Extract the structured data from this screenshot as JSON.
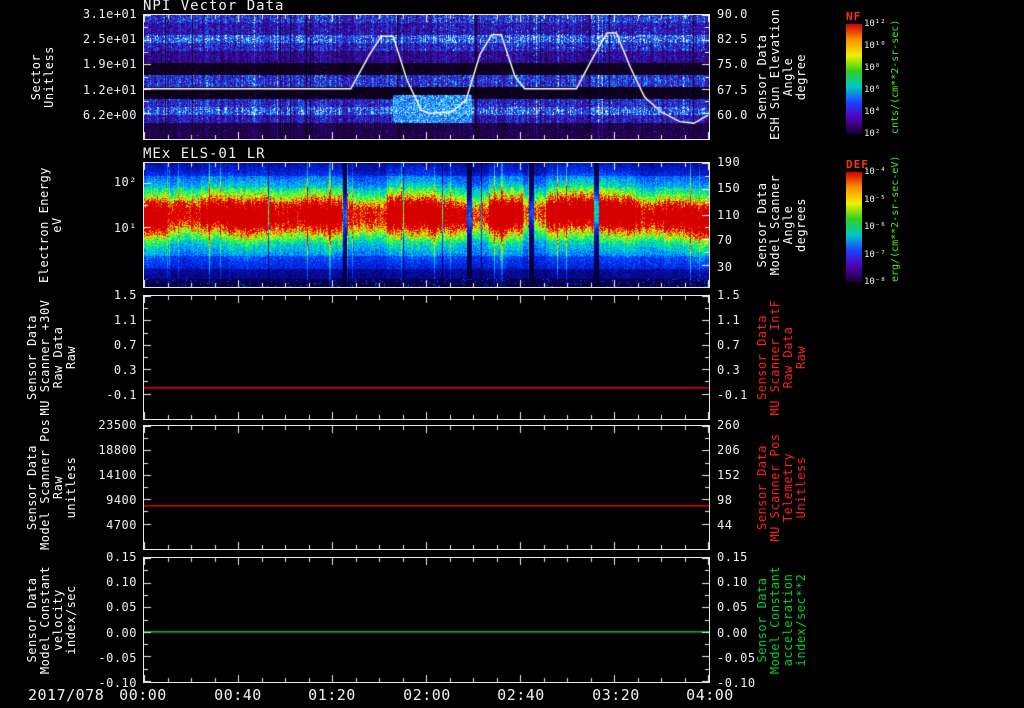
{
  "xaxis": {
    "date_label": "2017/078",
    "tick_labels": [
      "00:00",
      "00:40",
      "01:20",
      "02:00",
      "02:40",
      "03:20",
      "04:00"
    ],
    "t_range_min": [
      0,
      240
    ]
  },
  "chart_data": [
    {
      "type": "spectrogram",
      "title": "NPI Vector Data",
      "ylabel_left_lines": [
        "Sector",
        "Unitless"
      ],
      "yticks_left": [
        {
          "label": "3.1e+01",
          "frac": 0.0
        },
        {
          "label": "2.5e+01",
          "frac": 0.2
        },
        {
          "label": "1.9e+01",
          "frac": 0.4
        },
        {
          "label": "1.2e+01",
          "frac": 0.6
        },
        {
          "label": "6.2e+00",
          "frac": 0.8
        }
      ],
      "ylabel_right_lines": [
        "Sensor Data",
        "ESH Sun Elevation",
        "Angle",
        "degree"
      ],
      "ylabel_right_color": "#ffffff",
      "yticks_right": [
        {
          "label": "90.0",
          "frac": 0.0
        },
        {
          "label": "82.5",
          "frac": 0.2
        },
        {
          "label": "75.0",
          "frac": 0.4
        },
        {
          "label": "67.5",
          "frac": 0.6
        },
        {
          "label": "60.0",
          "frac": 0.8
        }
      ],
      "colorbar": {
        "label": "NF",
        "label_color": "#ff3018",
        "tick_labels": [
          "10¹²",
          "10¹⁰",
          "10⁸",
          "10⁶",
          "10⁴",
          "10²"
        ],
        "units": "cnts/(cm**2-sr-sec)",
        "units_color": "#58e818",
        "gradient": [
          "#d00000",
          "#ff9000",
          "#f0f000",
          "#30d020",
          "#00c8c8",
          "#2040ff",
          "#5000b0",
          "#180030"
        ]
      },
      "overlay_line": {
        "name": "ESH Sun Elevation Angle",
        "color": "#ffffff",
        "units": "degrees",
        "axis": {
          "top_value": 90.0,
          "bottom_value": 52.5
        },
        "points": [
          [
            0,
            67.5
          ],
          [
            88,
            67.5
          ],
          [
            96,
            78
          ],
          [
            101,
            83.5
          ],
          [
            106,
            83.5
          ],
          [
            112,
            70
          ],
          [
            118,
            61
          ],
          [
            122,
            60
          ],
          [
            131,
            60.5
          ],
          [
            137,
            64
          ],
          [
            143,
            78
          ],
          [
            148,
            84
          ],
          [
            152,
            84
          ],
          [
            158,
            71
          ],
          [
            162,
            67.5
          ],
          [
            184,
            67.5
          ],
          [
            191,
            77
          ],
          [
            197,
            84.5
          ],
          [
            201,
            84.5
          ],
          [
            207,
            74
          ],
          [
            213,
            65
          ],
          [
            220,
            60.5
          ],
          [
            228,
            57.5
          ],
          [
            234,
            57
          ],
          [
            240,
            59.5
          ]
        ]
      },
      "texture": {
        "row_profile": [
          {
            "f0": 0.0,
            "f1": 0.08,
            "v": 0.5
          },
          {
            "f0": 0.08,
            "f1": 0.15,
            "v": 0.38
          },
          {
            "f0": 0.15,
            "f1": 0.22,
            "v": 0.62
          },
          {
            "f0": 0.22,
            "f1": 0.3,
            "v": 0.45
          },
          {
            "f0": 0.3,
            "f1": 0.38,
            "v": 0.3
          },
          {
            "f0": 0.38,
            "f1": 0.48,
            "v": 0.07
          },
          {
            "f0": 0.48,
            "f1": 0.58,
            "v": 0.5
          },
          {
            "f0": 0.58,
            "f1": 0.67,
            "v": 0.06
          },
          {
            "f0": 0.67,
            "f1": 0.74,
            "v": 0.45
          },
          {
            "f0": 0.74,
            "f1": 0.8,
            "v": 0.62
          },
          {
            "f0": 0.8,
            "f1": 0.88,
            "v": 0.4
          },
          {
            "f0": 0.88,
            "f1": 1.01,
            "v": 0.16
          }
        ]
      }
    },
    {
      "type": "spectrogram",
      "title": "MEx ELS-01 LR",
      "yscale": "log",
      "ylabel_left_lines": [
        "Electron Energy",
        "eV"
      ],
      "yticks_left": [
        {
          "label": "10²",
          "frac": 0.16
        },
        {
          "label": "10¹",
          "frac": 0.52
        }
      ],
      "ylabel_right_lines": [
        "Sensor Data",
        "Model Scanner",
        "Angle",
        "degrees"
      ],
      "ylabel_right_color": "#ffffff",
      "yticks_right": [
        {
          "label": "190",
          "frac": 0.0
        },
        {
          "label": "150",
          "frac": 0.21
        },
        {
          "label": "110",
          "frac": 0.42
        },
        {
          "label": "70",
          "frac": 0.62
        },
        {
          "label": "30",
          "frac": 0.83
        }
      ],
      "colorbar": {
        "label": "DEF",
        "label_color": "#ff3018",
        "tick_labels": [
          "10⁻⁴",
          "10⁻⁵",
          "10⁻⁶",
          "10⁻⁷",
          "10⁻⁸"
        ],
        "units": "erg/(cm**2-sr-sec-eV)",
        "units_color": "#58e818",
        "gradient": [
          "#d00000",
          "#ff9000",
          "#f0f000",
          "#30d020",
          "#00c8c8",
          "#2040ff",
          "#5000b0",
          "#180030"
        ]
      },
      "texture": {
        "amp_profile": [
          [
            0,
            0.04,
            1.0
          ],
          [
            0.04,
            0.1,
            0.7
          ],
          [
            0.1,
            0.15,
            0.9
          ],
          [
            0.15,
            0.23,
            1.0
          ],
          [
            0.23,
            0.28,
            0.8
          ],
          [
            0.28,
            0.35,
            0.95
          ],
          [
            0.35,
            0.43,
            0.6
          ],
          [
            0.43,
            0.52,
            1.0
          ],
          [
            0.52,
            0.57,
            0.85
          ],
          [
            0.57,
            0.61,
            0.55
          ],
          [
            0.61,
            0.67,
            1.0
          ],
          [
            0.67,
            0.71,
            0.5
          ],
          [
            0.71,
            0.79,
            0.95
          ],
          [
            0.79,
            0.87,
            1.0
          ],
          [
            0.87,
            0.92,
            0.75
          ],
          [
            0.92,
            1.01,
            0.9
          ]
        ],
        "dark_streaks": [
          0.355,
          0.575,
          0.685,
          0.8
        ]
      }
    },
    {
      "type": "line",
      "ylabel_left_lines": [
        "Sensor Data",
        "MU Scanner +30V",
        "Raw Data",
        "Raw"
      ],
      "ylim": [
        1.5,
        -0.5
      ],
      "yticks_left": [
        {
          "label": "1.5",
          "frac": 0.0
        },
        {
          "label": "1.1",
          "frac": 0.2
        },
        {
          "label": "0.7",
          "frac": 0.4
        },
        {
          "label": "0.3",
          "frac": 0.6
        },
        {
          "label": "-0.1",
          "frac": 0.8
        }
      ],
      "ylabel_right_lines": [
        "Sensor Data",
        "MU Scanner IntF",
        "Raw Data",
        "Raw"
      ],
      "ylabel_right_color": "#ff2018",
      "yticks_right": [
        {
          "label": "1.5",
          "frac": 0.0
        },
        {
          "label": "1.1",
          "frac": 0.2
        },
        {
          "label": "0.7",
          "frac": 0.4
        },
        {
          "label": "0.3",
          "frac": 0.6
        },
        {
          "label": "-0.1",
          "frac": 0.8
        }
      ],
      "series": [
        {
          "name": "MU Scanner +30V Raw Data",
          "color": "#e00000",
          "value": 0.0
        }
      ]
    },
    {
      "type": "line",
      "ylabel_left_lines": [
        "Sensor Data",
        "Model Scanner Pos",
        "Raw",
        "unitless"
      ],
      "ylim": [
        23500,
        0
      ],
      "yticks_left": [
        {
          "label": "23500",
          "frac": 0.0
        },
        {
          "label": "18800",
          "frac": 0.2
        },
        {
          "label": "14100",
          "frac": 0.4
        },
        {
          "label": "9400",
          "frac": 0.6
        },
        {
          "label": "4700",
          "frac": 0.8
        }
      ],
      "ylabel_right_lines": [
        "Sensor Data",
        "MU Scanner Pos",
        "Telemetry",
        "Unitless"
      ],
      "ylabel_right_color": "#ff2018",
      "yticks_right": [
        {
          "label": "260",
          "frac": 0.0
        },
        {
          "label": "206",
          "frac": 0.2
        },
        {
          "label": "152",
          "frac": 0.4
        },
        {
          "label": "98",
          "frac": 0.6
        },
        {
          "label": "44",
          "frac": 0.8
        }
      ],
      "series": [
        {
          "name": "Model Scanner Pos Raw",
          "color": "#e00000",
          "value": 8300
        }
      ]
    },
    {
      "type": "line",
      "ylabel_left_lines": [
        "Sensor Data",
        "Model Constant",
        "velocity",
        "index/sec"
      ],
      "ylim": [
        0.15,
        -0.1
      ],
      "yticks_left": [
        {
          "label": "0.15",
          "frac": 0.0
        },
        {
          "label": "0.10",
          "frac": 0.2
        },
        {
          "label": "0.05",
          "frac": 0.4
        },
        {
          "label": "0.00",
          "frac": 0.6
        },
        {
          "label": "-0.05",
          "frac": 0.8
        },
        {
          "label": "-0.10",
          "frac": 1.0
        }
      ],
      "ylabel_right_lines": [
        "Sensor Data",
        "Model Constant",
        "acceleration",
        "index/sec**2"
      ],
      "ylabel_right_color": "#00d028",
      "yticks_right": [
        {
          "label": "0.15",
          "frac": 0.0
        },
        {
          "label": "0.10",
          "frac": 0.2
        },
        {
          "label": "0.05",
          "frac": 0.4
        },
        {
          "label": "0.00",
          "frac": 0.6
        },
        {
          "label": "-0.05",
          "frac": 0.8
        },
        {
          "label": "-0.10",
          "frac": 1.0
        }
      ],
      "series": [
        {
          "name": "Model Constant velocity",
          "color": "#00b830",
          "value": 0.0
        }
      ]
    }
  ]
}
